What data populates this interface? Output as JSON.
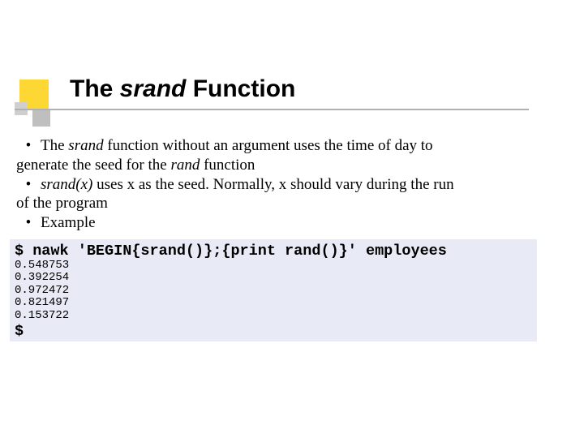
{
  "title": {
    "the": "The ",
    "srand": "srand",
    "func": " Function"
  },
  "bullets": {
    "b1_pre": "The ",
    "b1_srand": "srand",
    "b1_mid": " function without an argument uses the time of day to",
    "b1_wrap_pre": "generate the seed for the ",
    "b1_rand": "rand",
    "b1_wrap_post": " function",
    "b2_srandx": "srand(x)",
    "b2_rest": " uses x as the seed. Normally, x should vary during the run",
    "b2_wrap": "of the program",
    "b3": "Example"
  },
  "code": {
    "cmd": "$ nawk 'BEGIN{srand()};{print rand()}' employees",
    "out1": "0.548753",
    "out2": "0.392254",
    "out3": "0.972472",
    "out4": "0.821497",
    "out5": "0.153722",
    "prompt": "$"
  }
}
